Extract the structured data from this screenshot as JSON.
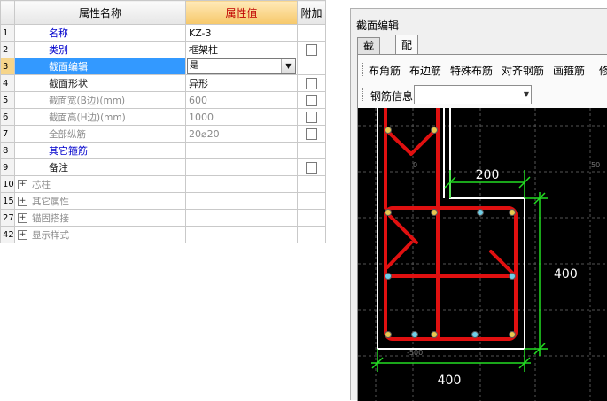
{
  "grid": {
    "headers": {
      "name": "属性名称",
      "value": "属性值",
      "extra": "附加"
    },
    "rows": [
      {
        "num": "1",
        "name": "名称",
        "value": "KZ-3",
        "style": "blue",
        "check": false
      },
      {
        "num": "2",
        "name": "类别",
        "value": "框架柱",
        "style": "blue",
        "check": true
      },
      {
        "num": "3",
        "name": "截面编辑",
        "value": "是",
        "style": "blue",
        "check": false,
        "selected": true
      },
      {
        "num": "4",
        "name": "截面形状",
        "value": "异形",
        "style": "dark",
        "check": true
      },
      {
        "num": "5",
        "name": "截面宽(B边)(mm)",
        "value": "600",
        "style": "gray",
        "check": true
      },
      {
        "num": "6",
        "name": "截面高(H边)(mm)",
        "value": "1000",
        "style": "gray",
        "check": true
      },
      {
        "num": "7",
        "name": "全部纵筋",
        "value": "20⌀20",
        "style": "gray",
        "check": true
      },
      {
        "num": "8",
        "name": "其它箍筋",
        "value": "",
        "style": "blue",
        "check": false
      },
      {
        "num": "9",
        "name": "备注",
        "value": "",
        "style": "dark",
        "check": true
      },
      {
        "num": "10",
        "name": "芯柱",
        "value": "",
        "style": "group",
        "check": false
      },
      {
        "num": "15",
        "name": "其它属性",
        "value": "",
        "style": "group",
        "check": false
      },
      {
        "num": "27",
        "name": "锚固搭接",
        "value": "",
        "style": "group",
        "check": false
      },
      {
        "num": "42",
        "name": "显示样式",
        "value": "",
        "style": "group",
        "check": false
      }
    ]
  },
  "panel": {
    "title": "截面编辑",
    "tabs": [
      "截面",
      "配筋"
    ],
    "active_tab": 1,
    "toolbar": [
      "布角筋",
      "布边筋",
      "特殊布筋",
      "对齐钢筋",
      "画箍筋",
      "修"
    ],
    "rebar_info_label": "钢筋信息",
    "rebar_info_value": "",
    "dimensions": {
      "top": "200",
      "right": "400",
      "bottom": "400"
    },
    "grid_labels": {
      "top": "0",
      "right": "50",
      "bottom": "-500"
    }
  },
  "colors": {
    "rebar": "#e01010",
    "dimension": "#22dd22",
    "outline": "#ffffff",
    "selection": "#3399ff"
  }
}
